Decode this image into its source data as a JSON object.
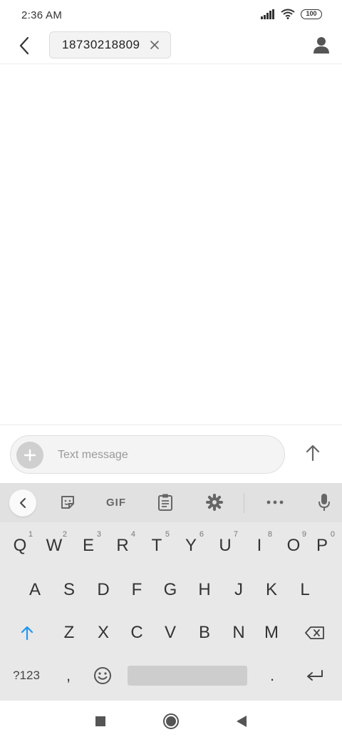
{
  "status_bar": {
    "time": "2:36 AM",
    "battery": "100"
  },
  "header": {
    "recipient": "18730218809"
  },
  "compose": {
    "placeholder": "Text message"
  },
  "keyboard": {
    "toolbar": {
      "gif_label": "GIF"
    },
    "row1": [
      {
        "letter": "Q",
        "hint": "1"
      },
      {
        "letter": "W",
        "hint": "2"
      },
      {
        "letter": "E",
        "hint": "3"
      },
      {
        "letter": "R",
        "hint": "4"
      },
      {
        "letter": "T",
        "hint": "5"
      },
      {
        "letter": "Y",
        "hint": "6"
      },
      {
        "letter": "U",
        "hint": "7"
      },
      {
        "letter": "I",
        "hint": "8"
      },
      {
        "letter": "O",
        "hint": "9"
      },
      {
        "letter": "P",
        "hint": "0"
      }
    ],
    "row2": [
      "A",
      "S",
      "D",
      "F",
      "G",
      "H",
      "J",
      "K",
      "L"
    ],
    "row3": [
      "Z",
      "X",
      "C",
      "V",
      "B",
      "N",
      "M"
    ],
    "symbols_label": "?123",
    "comma": ",",
    "period": "."
  },
  "colors": {
    "accent": "#2196f3",
    "keyboard_bg": "#e8e8e8",
    "toolbar_bg": "#e1e1e1"
  }
}
